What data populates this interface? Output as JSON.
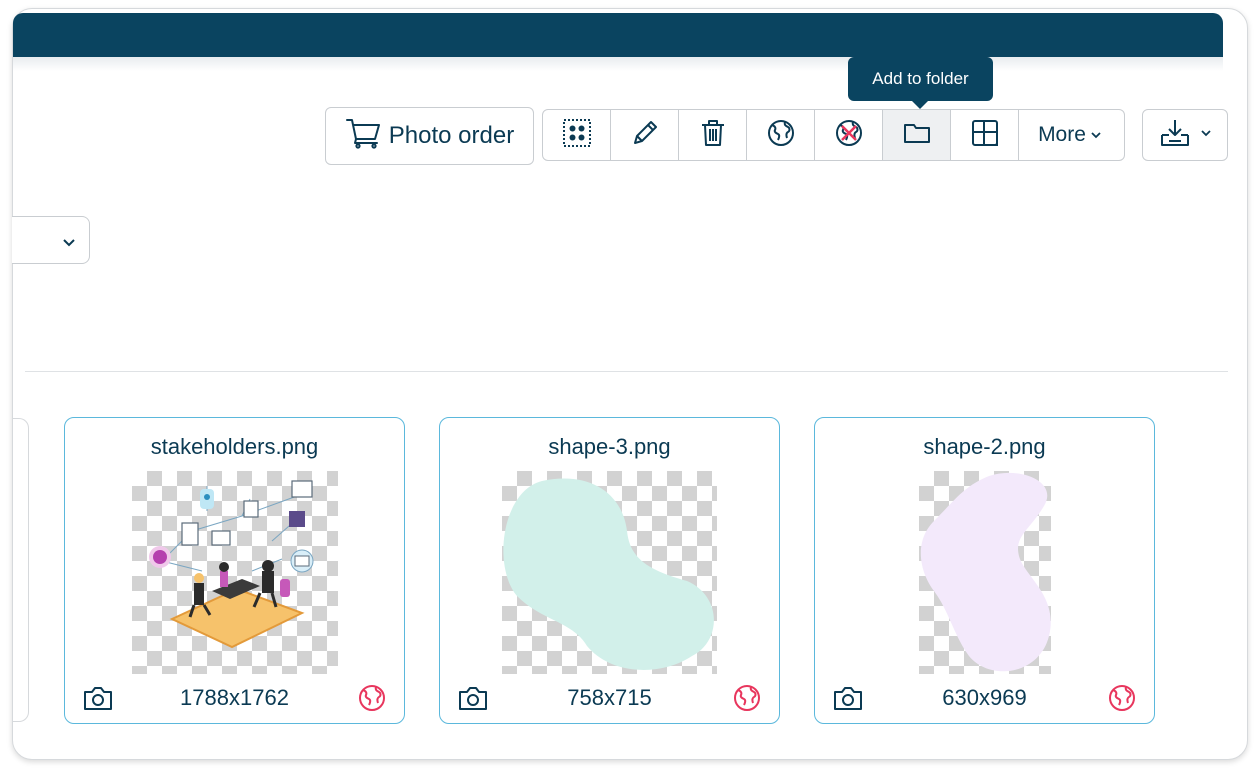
{
  "tooltip": {
    "text": "Add to folder"
  },
  "toolbar": {
    "photo_order_label": "Photo order",
    "tools": [
      {
        "icon": "select-all-icon"
      },
      {
        "icon": "pencil-icon"
      },
      {
        "icon": "trash-icon"
      },
      {
        "icon": "globe-icon"
      },
      {
        "icon": "globe-unpublish-icon"
      },
      {
        "icon": "folder-icon"
      },
      {
        "icon": "resize-icon"
      }
    ],
    "more_label": "More",
    "download_icon": "download-icon"
  },
  "colors": {
    "brand_dark": "#0a4460",
    "card_border": "#5bb8dc",
    "public_globe": "#e8365d",
    "shape3_fill": "#d2f0ea",
    "shape2_fill": "#f3e9fb"
  },
  "assets": [
    {
      "title": "stakeholders.png",
      "dimensions": "1788x1762",
      "type_icon": "camera-icon",
      "status_icon": "globe-icon"
    },
    {
      "title": "shape-3.png",
      "dimensions": "758x715",
      "type_icon": "camera-icon",
      "status_icon": "globe-icon"
    },
    {
      "title": "shape-2.png",
      "dimensions": "630x969",
      "type_icon": "camera-icon",
      "status_icon": "globe-icon"
    }
  ]
}
